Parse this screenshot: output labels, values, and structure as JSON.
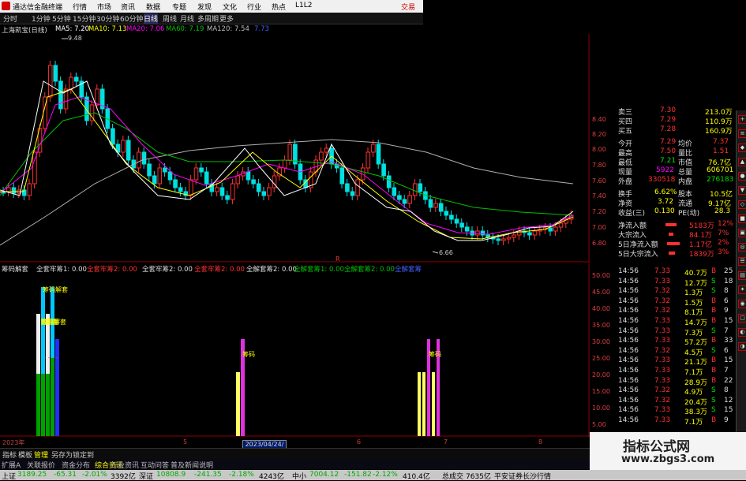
{
  "menubar": {
    "app_title": "通达信金融终端",
    "items": [
      "行情",
      "市场",
      "资讯",
      "数据",
      "专题",
      "发现",
      "文化",
      "行业",
      "热点",
      "L1L2"
    ],
    "trade": "交易"
  },
  "periodbar": {
    "items": [
      "分时",
      "1分钟",
      "5分钟",
      "15分钟",
      "30分钟",
      "60分钟",
      "日线",
      "周线",
      "月线",
      "多周期",
      "更多"
    ],
    "active_index": 6
  },
  "ma_header": {
    "title": "上海凯宝(日线)",
    "ma5": "MA5: 7.20",
    "ma10": "MA10: 7.13",
    "ma20": "MA20: 7.06",
    "ma60": "MA60: 7.19",
    "ma120": "MA120: 7.54",
    "extra": "7.73"
  },
  "main_annotations": {
    "high": "9.48",
    "low": "6.66",
    "marker": "R"
  },
  "main_axis": [
    "8.40",
    "8.20",
    "8.00",
    "7.80",
    "7.60",
    "7.40",
    "7.20",
    "7.00",
    "6.80"
  ],
  "sub_header": {
    "title": "筹码解套",
    "i1": "全套牢筹1: 0.00",
    "i2": "全套牢筹2: 0.00",
    "i3": "全套牢筹2: 0.00",
    "i4": "全套牢筹2: 0.00",
    "i5": "全解套筹2: 0.00",
    "i6": "全解套筹1: 0.00",
    "i7": "全解套筹2: 0.00",
    "i8": "全解套筹1: 0.00",
    "i9": "全解套筹"
  },
  "sub_axis": [
    "50.00",
    "45.00",
    "40.00",
    "35.00",
    "30.00",
    "25.00",
    "20.00",
    "15.00",
    "10.00",
    "5.00"
  ],
  "sub_labels": {
    "l1": "筹码解套",
    "l2": "筹码解套",
    "l3": "筹码",
    "l4": "筹码"
  },
  "right_panel": {
    "rows": [
      {
        "k": "卖三",
        "v": "7.30",
        "n": "213.0万"
      },
      {
        "k": "买四",
        "v": "7.29",
        "n": "110.9万"
      },
      {
        "k": "买五",
        "v": "7.28",
        "n": "160.9万"
      },
      {
        "k": "今开",
        "v": "7.29",
        "k2": "均价",
        "v2": "7.37"
      },
      {
        "k": "最高",
        "v": "7.50",
        "k2": "量比",
        "v2": "1.51"
      },
      {
        "k": "最低",
        "v": "7.21",
        "k2": "市值",
        "v2": "76.7亿"
      },
      {
        "k": "现量",
        "v": "5922",
        "k2": "总量",
        "v2": "606701"
      },
      {
        "k": "外盘",
        "v": "330518",
        "k2": "内盘",
        "v2": "276183"
      },
      {
        "k": "换手",
        "v": "6.62%",
        "k2": "股本",
        "v2": "10.5亿"
      },
      {
        "k": "净资",
        "v": "3.72",
        "k2": "流通",
        "v2": "9.17亿"
      },
      {
        "k": "收益(三)",
        "v": "0.130",
        "k2": "PE(动)",
        "v2": "28.3"
      },
      {
        "k": "净流入额",
        "v": "5183万",
        "v2": "12%"
      },
      {
        "k": "大宗流入",
        "v": "84.1万",
        "v2": "7%"
      },
      {
        "k": "5日净流入额",
        "v": "1.17亿",
        "v2": "2%"
      },
      {
        "k": "5日大宗流入",
        "v": "1839万",
        "v2": "3%"
      }
    ]
  },
  "ticks": [
    {
      "t": "14:56",
      "p": "7.33",
      "v": "40.7万",
      "d": "B",
      "n": "25"
    },
    {
      "t": "14:56",
      "p": "7.33",
      "v": "12.7万",
      "d": "S",
      "n": "18"
    },
    {
      "t": "14:56",
      "p": "7.32",
      "v": "1.3万",
      "d": "S",
      "n": "8"
    },
    {
      "t": "14:56",
      "p": "7.32",
      "v": "1.5万",
      "d": "B",
      "n": "6"
    },
    {
      "t": "14:56",
      "p": "7.32",
      "v": "8.1万",
      "d": "B",
      "n": "9"
    },
    {
      "t": "14:56",
      "p": "7.33",
      "v": "14.7万",
      "d": "B",
      "n": "15"
    },
    {
      "t": "14:56",
      "p": "7.33",
      "v": "7.3万",
      "d": "S",
      "n": "7"
    },
    {
      "t": "14:56",
      "p": "7.33",
      "v": "57.2万",
      "d": "B",
      "n": "33"
    },
    {
      "t": "14:56",
      "p": "7.32",
      "v": "4.5万",
      "d": "S",
      "n": "6"
    },
    {
      "t": "14:56",
      "p": "7.33",
      "v": "21.1万",
      "d": "B",
      "n": "15"
    },
    {
      "t": "14:56",
      "p": "7.33",
      "v": "7.1万",
      "d": "B",
      "n": "7"
    },
    {
      "t": "14:56",
      "p": "7.33",
      "v": "28.9万",
      "d": "B",
      "n": "22"
    },
    {
      "t": "14:56",
      "p": "7.32",
      "v": "4.9万",
      "d": "S",
      "n": "8"
    },
    {
      "t": "14:56",
      "p": "7.32",
      "v": "20.4万",
      "d": "S",
      "n": "12"
    },
    {
      "t": "14:56",
      "p": "7.33",
      "v": "38.3万",
      "d": "S",
      "n": "15"
    },
    {
      "t": "14:56",
      "p": "7.33",
      "v": "7.1万",
      "d": "B",
      "n": "9"
    }
  ],
  "date_axis": [
    "2023年",
    "5",
    "6",
    "7",
    "8"
  ],
  "date_box": "2023/04/24/一",
  "bottom_tabs": [
    "指标",
    "模板",
    "管理",
    "另存为",
    "锁定到"
  ],
  "link_bar": [
    "扩展A",
    "关联报价",
    "资金分布",
    "综合资讯",
    "行业资讯",
    "互动问答",
    "普及新闻说明"
  ],
  "statusbar": {
    "sh_label": "上证",
    "sh_val": "3189.25",
    "sh_chg": "-65.31",
    "sh_pct": "-2.01%",
    "sh_amt": "3392亿",
    "sz_label": "深证",
    "sz_val": "10808.9",
    "sz_chg": "-241.35",
    "sz_pct": "-2.18%",
    "sz_amt": "4243亿",
    "zx_label": "中小",
    "zx_val": "7004.12",
    "zx_chg": "-151.82",
    "zx_pct": "-2.12%",
    "zx_amt": "410.4亿",
    "total_label": "总成交",
    "total_val": "7635亿",
    "broker": "平安证券长沙行情"
  },
  "watermark": {
    "line1": "指标公式网",
    "line2": "www.zbgs3.com"
  },
  "colors": {
    "up": "#ff3030",
    "down": "#00e0e0",
    "ma5": "#ffffff",
    "ma10": "#ffff00",
    "ma20": "#ff00ff",
    "ma60": "#00c000",
    "ma120": "#a0a0a0"
  }
}
